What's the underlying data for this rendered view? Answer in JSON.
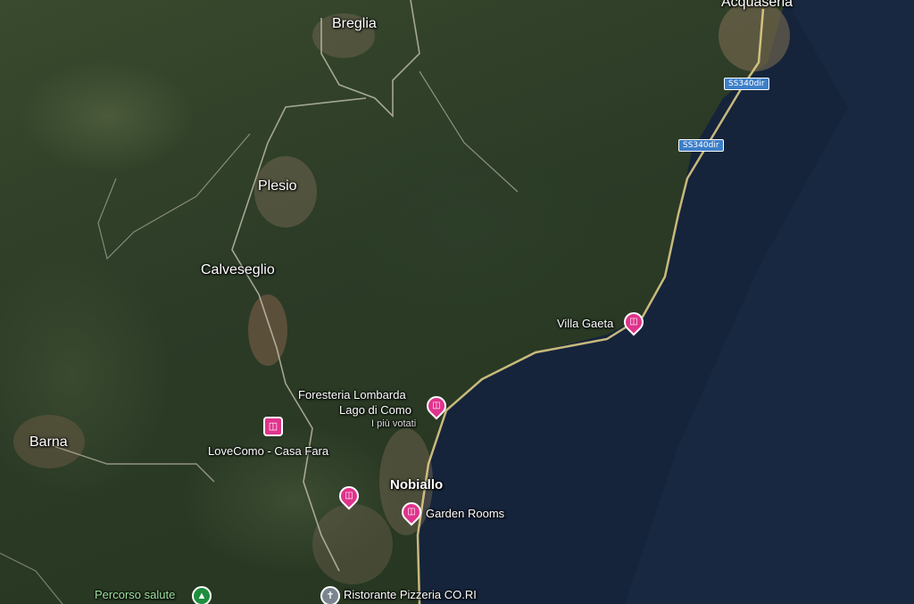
{
  "places": {
    "breglia": "Breglia",
    "acquaseria": "Acquaseria",
    "plesio": "Plesio",
    "calveseglio": "Calveseglio",
    "barna": "Barna",
    "nobiallo": "Nobiallo"
  },
  "pois": {
    "villa_gaeta": "Villa Gaeta",
    "foresteria_line1": "Foresteria Lombarda",
    "foresteria_line2": "Lago di Como",
    "foresteria_sub": "I più votati",
    "lovecomo": "LoveComo - Casa Fara",
    "garden_rooms": "Garden Rooms",
    "ristorante": "Ristorante Pizzeria CO.RI",
    "percorso": "Percorso salute"
  },
  "roads": {
    "ss340_1": "SS340dir",
    "ss340_2": "SS340dir"
  },
  "icons": {
    "hotel": "bed-icon",
    "restaurant": "fork-knife-icon",
    "park": "tree-icon"
  },
  "colors": {
    "hotel_pin": "#e0338c",
    "restaurant_pin": "#7b8590",
    "park_pin": "#1e8e3e",
    "lake": "#14233a",
    "road_shield": "#3d7fc9"
  }
}
